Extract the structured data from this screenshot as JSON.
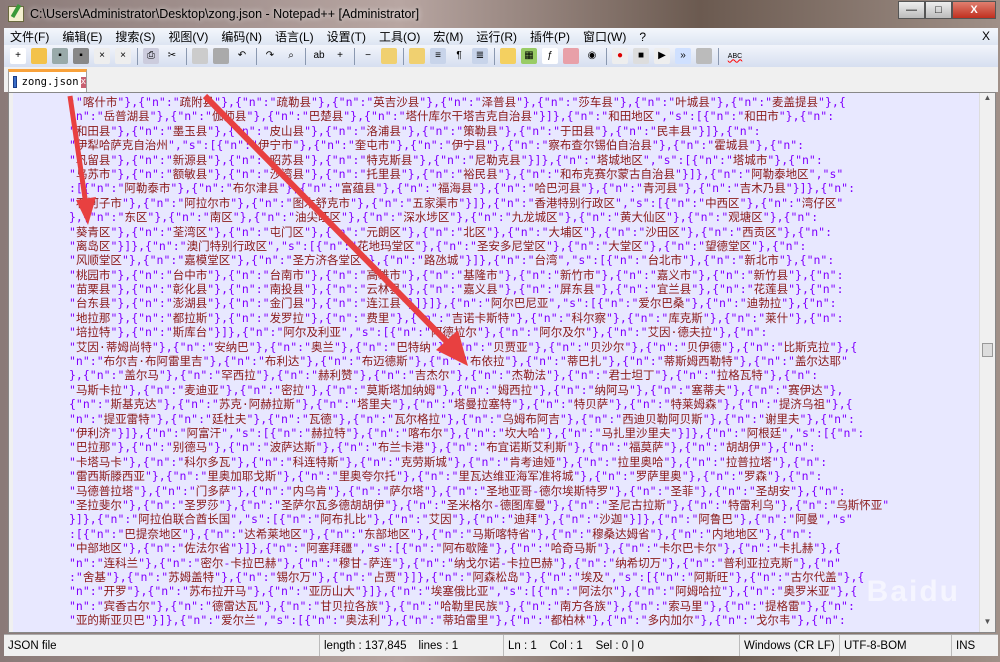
{
  "window": {
    "title": "C:\\Users\\Administrator\\Desktop\\zong.json - Notepad++ [Administrator]",
    "minimize": "—",
    "maximize": "□",
    "close": "X"
  },
  "menu": {
    "items": [
      "文件(F)",
      "编辑(E)",
      "搜索(S)",
      "视图(V)",
      "编码(N)",
      "语言(L)",
      "设置(T)",
      "工具(O)",
      "宏(M)",
      "运行(R)",
      "插件(P)",
      "窗口(W)",
      "?"
    ],
    "close": "X"
  },
  "toolbar": {
    "icons": [
      "new-file",
      "open-file",
      "save",
      "save-all",
      "close",
      "close-all",
      "print",
      "cut",
      "copy",
      "paste",
      "undo",
      "redo",
      "find",
      "replace",
      "zoom-in",
      "zoom-out",
      "sync-vertical",
      "sync-horizontal",
      "word-wrap",
      "show-all-chars",
      "indent-guide",
      "udl",
      "doc-map",
      "function-list",
      "folder-workspace",
      "monitor",
      "record-macro",
      "stop-macro",
      "play-macro",
      "run-macro-multiple",
      "save-macro",
      "spell-check"
    ],
    "spell_label": "ABC"
  },
  "tab": {
    "label": "zong.json",
    "close": "x"
  },
  "editor": {
    "lines": [
      ":\"喀什市\"},{\"n\":\"疏附县\"},{\"n\":\"疏勒县\"},{\"n\":\"英吉沙县\"},{\"n\":\"泽普县\"},{\"n\":\"莎车县\"},{\"n\":\"叶城县\"},{\"n\":\"麦盖提县\"},{",
      "\"n\":\"岳普湖县\"},{\"n\":\"伽师县\"},{\"n\":\"巴楚县\"},{\"n\":\"塔什库尔干塔吉克自治县\"}]},{\"n\":\"和田地区\",\"s\":[{\"n\":\"和田市\"},{\"n\":",
      "\"和田县\"},{\"n\":\"墨玉县\"},{\"n\":\"皮山县\"},{\"n\":\"洛浦县\"},{\"n\":\"策勒县\"},{\"n\":\"于田县\"},{\"n\":\"民丰县\"}]},{\"n\":",
      "\"伊犁哈萨克自治州\",\"s\":[{\"n\":\"伊宁市\"},{\"n\":\"奎屯市\"},{\"n\":\"伊宁县\"},{\"n\":\"察布查尔锡伯自治县\"},{\"n\":\"霍城县\"},{\"n\":",
      "\"巩留县\"},{\"n\":\"新源县\"},{\"n\":\"昭苏县\"},{\"n\":\"特克斯县\"},{\"n\":\"尼勒克县\"}]},{\"n\":\"塔城地区\",\"s\":[{\"n\":\"塔城市\"},{\"n\":",
      "\"乌苏市\"},{\"n\":\"额敏县\"},{\"n\":\"沙湾县\"},{\"n\":\"托里县\"},{\"n\":\"裕民县\"},{\"n\":\"和布克赛尔蒙古自治县\"}]},{\"n\":\"阿勒泰地区\",\"s\"",
      ":[{\"n\":\"阿勒泰市\"},{\"n\":\"布尔津县\"},{\"n\":\"富蕴县\"},{\"n\":\"福海县\"},{\"n\":\"哈巴河县\"},{\"n\":\"青河县\"},{\"n\":\"吉木乃县\"}]},{\"n\":",
      "\"石河子市\"},{\"n\":\"阿拉尔市\"},{\"n\":\"图木舒克市\"},{\"n\":\"五家渠市\"}]},{\"n\":\"香港特别行政区\",\"s\":[{\"n\":\"中西区\"},{\"n\":\"湾仔区\"",
      "},{\"n\":\"东区\"},{\"n\":\"南区\"},{\"n\":\"油尖旺区\"},{\"n\":\"深水埗区\"},{\"n\":\"九龙城区\"},{\"n\":\"黄大仙区\"},{\"n\":\"观塘区\"},{\"n\":",
      "\"葵青区\"},{\"n\":\"荃湾区\"},{\"n\":\"屯门区\"},{\"n\":\"元朗区\"},{\"n\":\"北区\"},{\"n\":\"大埔区\"},{\"n\":\"沙田区\"},{\"n\":\"西贡区\"},{\"n\":",
      "\"离岛区\"}]},{\"n\":\"澳门特别行政区\",\"s\":[{\"n\":\"花地玛堂区\"},{\"n\":\"圣安多尼堂区\"},{\"n\":\"大堂区\"},{\"n\":\"望德堂区\"},{\"n\":",
      "\"风顺堂区\"},{\"n\":\"嘉模堂区\"},{\"n\":\"圣方济各堂区\"},{\"n\":\"路氹城\"}]},{\"n\":\"台湾\",\"s\":[{\"n\":\"台北市\"},{\"n\":\"新北市\"},{\"n\":",
      "\"桃园市\"},{\"n\":\"台中市\"},{\"n\":\"台南市\"},{\"n\":\"高雄市\"},{\"n\":\"基隆市\"},{\"n\":\"新竹市\"},{\"n\":\"嘉义市\"},{\"n\":\"新竹县\"},{\"n\":",
      "\"苗栗县\"},{\"n\":\"彰化县\"},{\"n\":\"南投县\"},{\"n\":\"云林县\"},{\"n\":\"嘉义县\"},{\"n\":\"屏东县\"},{\"n\":\"宜兰县\"},{\"n\":\"花莲县\"},{\"n\":",
      "\"台东县\"},{\"n\":\"澎湖县\"},{\"n\":\"金门县\"},{\"n\":\"连江县\"}]}]},{\"n\":\"阿尔巴尼亚\",\"s\":[{\"n\":\"爱尔巴桑\"},{\"n\":\"迪勃拉\"},{\"n\":",
      "\"地拉那\"},{\"n\":\"都拉斯\"},{\"n\":\"发罗拉\"},{\"n\":\"费里\"},{\"n\":\"吉诺卡斯特\"},{\"n\":\"科尔察\"},{\"n\":\"库克斯\"},{\"n\":\"莱什\"},{\"n\":",
      "\"培拉特\"},{\"n\":\"斯库台\"}]},{\"n\":\"阿尔及利亚\",\"s\":[{\"n\":\"阿德拉尔\"},{\"n\":\"阿尔及尔\"},{\"n\":\"艾因·德夫拉\"},{\"n\":",
      "\"艾因·蒂姆尚特\"},{\"n\":\"安纳巴\"},{\"n\":\"奥兰\"},{\"n\":\"巴特纳\"},{\"n\":\"贝贾亚\"},{\"n\":\"贝沙尔\"},{\"n\":\"贝伊德\"},{\"n\":\"比斯克拉\"},{",
      "\"n\":\"布尔吉·布阿雷里吉\"},{\"n\":\"布利达\"},{\"n\":\"布迈德斯\"},{\"n\":\"布依拉\"},{\"n\":\"蒂巴扎\"},{\"n\":\"蒂斯姆西勒特\"},{\"n\":\"盖尔达耶\"",
      "},{\"n\":\"盖尔马\"},{\"n\":\"罕西拉\"},{\"n\":\"赫利赞\"},{\"n\":\"吉杰尔\"},{\"n\":\"杰勒法\"},{\"n\":\"君士坦丁\"},{\"n\":\"拉格瓦特\"},{\"n\":",
      "\"马斯卡拉\"},{\"n\":\"麦迪亚\"},{\"n\":\"密拉\"},{\"n\":\"莫斯塔加纳姆\"},{\"n\":\"姆西拉\"},{\"n\":\"纳阿马\"},{\"n\":\"塞蒂夫\"},{\"n\":\"赛伊达\"},",
      "{\"n\":\"斯基克达\"},{\"n\":\"苏克·阿赫拉斯\"},{\"n\":\"塔里夫\"},{\"n\":\"塔曼拉塞特\"},{\"n\":\"特贝萨\"},{\"n\":\"特莱姆森\"},{\"n\":\"提济乌祖\"},{",
      "\"n\":\"提亚雷特\"},{\"n\":\"廷杜夫\"},{\"n\":\"瓦德\"},{\"n\":\"瓦尔格拉\"},{\"n\":\"乌姆布阿吉\"},{\"n\":\"西迪贝勒阿贝斯\"},{\"n\":\"谢里夫\"},{\"n\":",
      "\"伊利济\"}]},{\"n\":\"阿富汗\",\"s\":[{\"n\":\"赫拉特\"},{\"n\":\"喀布尔\"},{\"n\":\"坎大哈\"},{\"n\":\"马扎里沙里夫\"}]},{\"n\":\"阿根廷\",\"s\":[{\"n\":",
      "\"巴拉那\"},{\"n\":\"别德马\"},{\"n\":\"波萨达斯\"},{\"n\":\"布兰卡港\"},{\"n\":\"布宜诺斯艾利斯\"},{\"n\":\"福莫萨\"},{\"n\":\"胡胡伊\"},{\"n\":",
      "\"卡塔马卡\"},{\"n\":\"科尔多瓦\"},{\"n\":\"科连特斯\"},{\"n\":\"克劳斯城\"},{\"n\":\"肯考迪娅\"},{\"n\":\"拉里奥哈\"},{\"n\":\"拉普拉塔\"},{\"n\":",
      "\"雷西斯滕西亚\"},{\"n\":\"里奥加耶戈斯\"},{\"n\":\"里奥夸尔托\"},{\"n\":\"里瓦达维亚海军准将城\"},{\"n\":\"罗萨里奥\"},{\"n\":\"罗森\"},{\"n\":",
      "\"马德普拉塔\"},{\"n\":\"门多萨\"},{\"n\":\"内乌肯\"},{\"n\":\"萨尔塔\"},{\"n\":\"圣地亚哥-德尔埃斯特罗\"},{\"n\":\"圣菲\"},{\"n\":\"圣胡安\"},{\"n\":",
      "\"圣拉斐尔\"},{\"n\":\"圣罗莎\"},{\"n\":\"圣萨尔瓦多德胡胡伊\"},{\"n\":\"圣米格尔-德图库曼\"},{\"n\":\"圣尼古拉斯\"},{\"n\":\"特雷利乌\"},{\"n\":\"乌斯怀亚\"",
      "}]},{\"n\":\"阿拉伯联合酋长国\",\"s\":[{\"n\":\"阿布扎比\"},{\"n\":\"艾因\"},{\"n\":\"迪拜\"},{\"n\":\"沙迦\"}]},{\"n\":\"阿鲁巴\"},{\"n\":\"阿曼\",\"s\"",
      ":[{\"n\":\"巴提奈地区\"},{\"n\":\"达希莱地区\"},{\"n\":\"东部地区\"},{\"n\":\"马斯喀特省\"},{\"n\":\"穆桑达姆省\"},{\"n\":\"内地地区\"},{\"n\":",
      "\"中部地区\"},{\"n\":\"佐法尔省\"}]},{\"n\":\"阿塞拜疆\",\"s\":[{\"n\":\"阿布歇隆\"},{\"n\":\"哈奇马斯\"},{\"n\":\"卡尔巴卡尔\"},{\"n\":\"卡扎赫\"},{",
      "\"n\":\"连科兰\"},{\"n\":\"密尔-卡拉巴赫\"},{\"n\":\"穆甘-萨连\"},{\"n\":\"纳戈尔诺-卡拉巴赫\"},{\"n\":\"纳希切万\"},{\"n\":\"普利亚拉克斯\"},{\"n\"",
      ":\"舍基\"},{\"n\":\"苏姆盖特\"},{\"n\":\"锡尔万\"},{\"n\":\"占贾\"}]},{\"n\":\"阿森松岛\"},{\"n\":\"埃及\",\"s\":[{\"n\":\"阿斯旺\"},{\"n\":\"古尔代盖\"},{",
      "\"n\":\"开罗\"},{\"n\":\"苏布拉开马\"},{\"n\":\"亚历山大\"}]},{\"n\":\"埃塞俄比亚\",\"s\":[{\"n\":\"阿法尔\"},{\"n\":\"阿姆哈拉\"},{\"n\":\"奥罗米亚\"},{",
      "\"n\":\"宾香古尔\"},{\"n\":\"德雷达瓦\"},{\"n\":\"甘贝拉各族\"},{\"n\":\"哈勒里民族\"},{\"n\":\"南方各族\"},{\"n\":\"索马里\"},{\"n\":\"提格雷\"},{\"n\":",
      "\"亚的斯亚贝巴\"}]},{\"n\":\"爱尔兰\",\"s\":[{\"n\":\"奥法利\"},{\"n\":\"蒂珀雷里\"},{\"n\":\"都柏林\"},{\"n\":\"多内加尔\"},{\"n\":\"戈尔韦\"},{\"n\":"
    ]
  },
  "statusbar": {
    "file_type": "JSON file",
    "length": "length : 137,845",
    "lines": "lines : 1",
    "position": "Ln : 1    Col : 1    Sel : 0 | 0",
    "eol": "Windows (CR LF)",
    "encoding": "UTF-8-BOM",
    "mode": "INS"
  },
  "watermark": "Baidu经验 jingyan.baidu.com",
  "colors": {
    "punct": "#8000ff",
    "string": "#8b1a1a",
    "background": "#e8e8ff",
    "annotation_arrow": "#e84040"
  }
}
